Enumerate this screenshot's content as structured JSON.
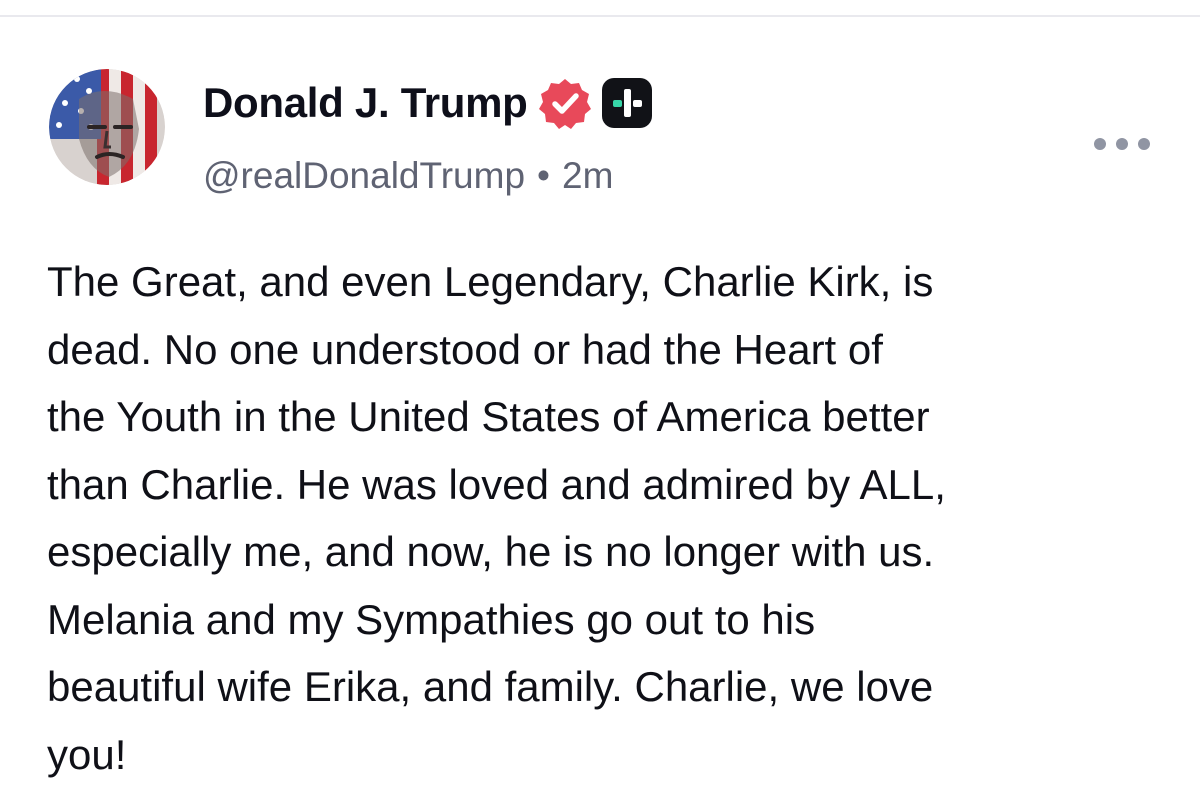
{
  "post": {
    "author": {
      "display_name": "Donald J. Trump",
      "handle": "@realDonaldTrump",
      "verified_icon": "verified-badge-icon",
      "plus_icon": "plus-badge-icon",
      "avatar_icon": "profile-avatar"
    },
    "separator": "•",
    "time_ago": "2m",
    "more_icon": "more-options-icon",
    "text": "The Great, and even Legendary, Charlie Kirk, is\ndead. No one understood or had the Heart of\nthe Youth in the United States of America better\nthan Charlie. He was loved and admired by ALL,\nespecially me, and now, he is no longer with us.\nMelania and my Sympathies go out to his\nbeautiful wife Erika, and family. Charlie, we love\nyou!"
  },
  "colors": {
    "verified": "#e8495a",
    "plus_badge": "#111217",
    "plus_accent": "#37d6a8",
    "handle_gray": "#5f6373",
    "more_dots": "#9095a3"
  }
}
